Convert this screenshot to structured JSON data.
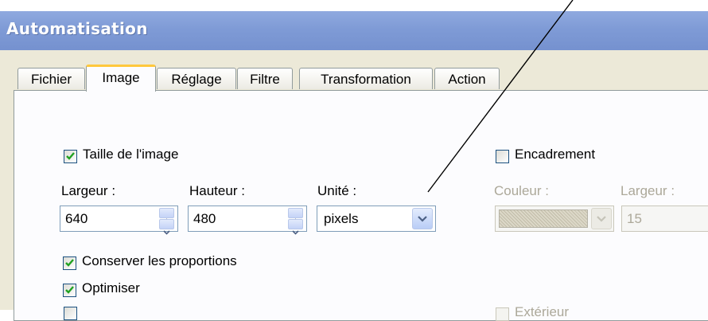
{
  "window": {
    "title": "Automatisation"
  },
  "tabs": [
    {
      "label": "Fichier"
    },
    {
      "label": "Image",
      "active": true
    },
    {
      "label": "Réglage"
    },
    {
      "label": "Filtre"
    },
    {
      "label": "Transformation"
    },
    {
      "label": "Action"
    }
  ],
  "image_size": {
    "checkbox_label": "Taille de l'image",
    "checked": true,
    "width_label": "Largeur :",
    "width_value": "640",
    "height_label": "Hauteur :",
    "height_value": "480",
    "unit_label": "Unité :",
    "unit_value": "pixels"
  },
  "options": {
    "keep_proportions_label": "Conserver les proportions",
    "keep_proportions_checked": true,
    "optimize_label": "Optimiser",
    "optimize_checked": true
  },
  "frame": {
    "checkbox_label": "Encadrement",
    "checked": false,
    "color_label": "Couleur :",
    "width_label": "Largeur :",
    "width_value": "15",
    "exterior_label": "Extérieur",
    "exterior_checked": false
  },
  "icons": {
    "check": "checkmark-icon",
    "spin_up": "spin-up-icon",
    "spin_down": "spin-down-icon",
    "dropdown": "chevron-down-icon"
  },
  "colors": {
    "titlebar": "#7f9bd6",
    "active_tab_accent": "#ffc83c",
    "check_green": "#21a121"
  }
}
